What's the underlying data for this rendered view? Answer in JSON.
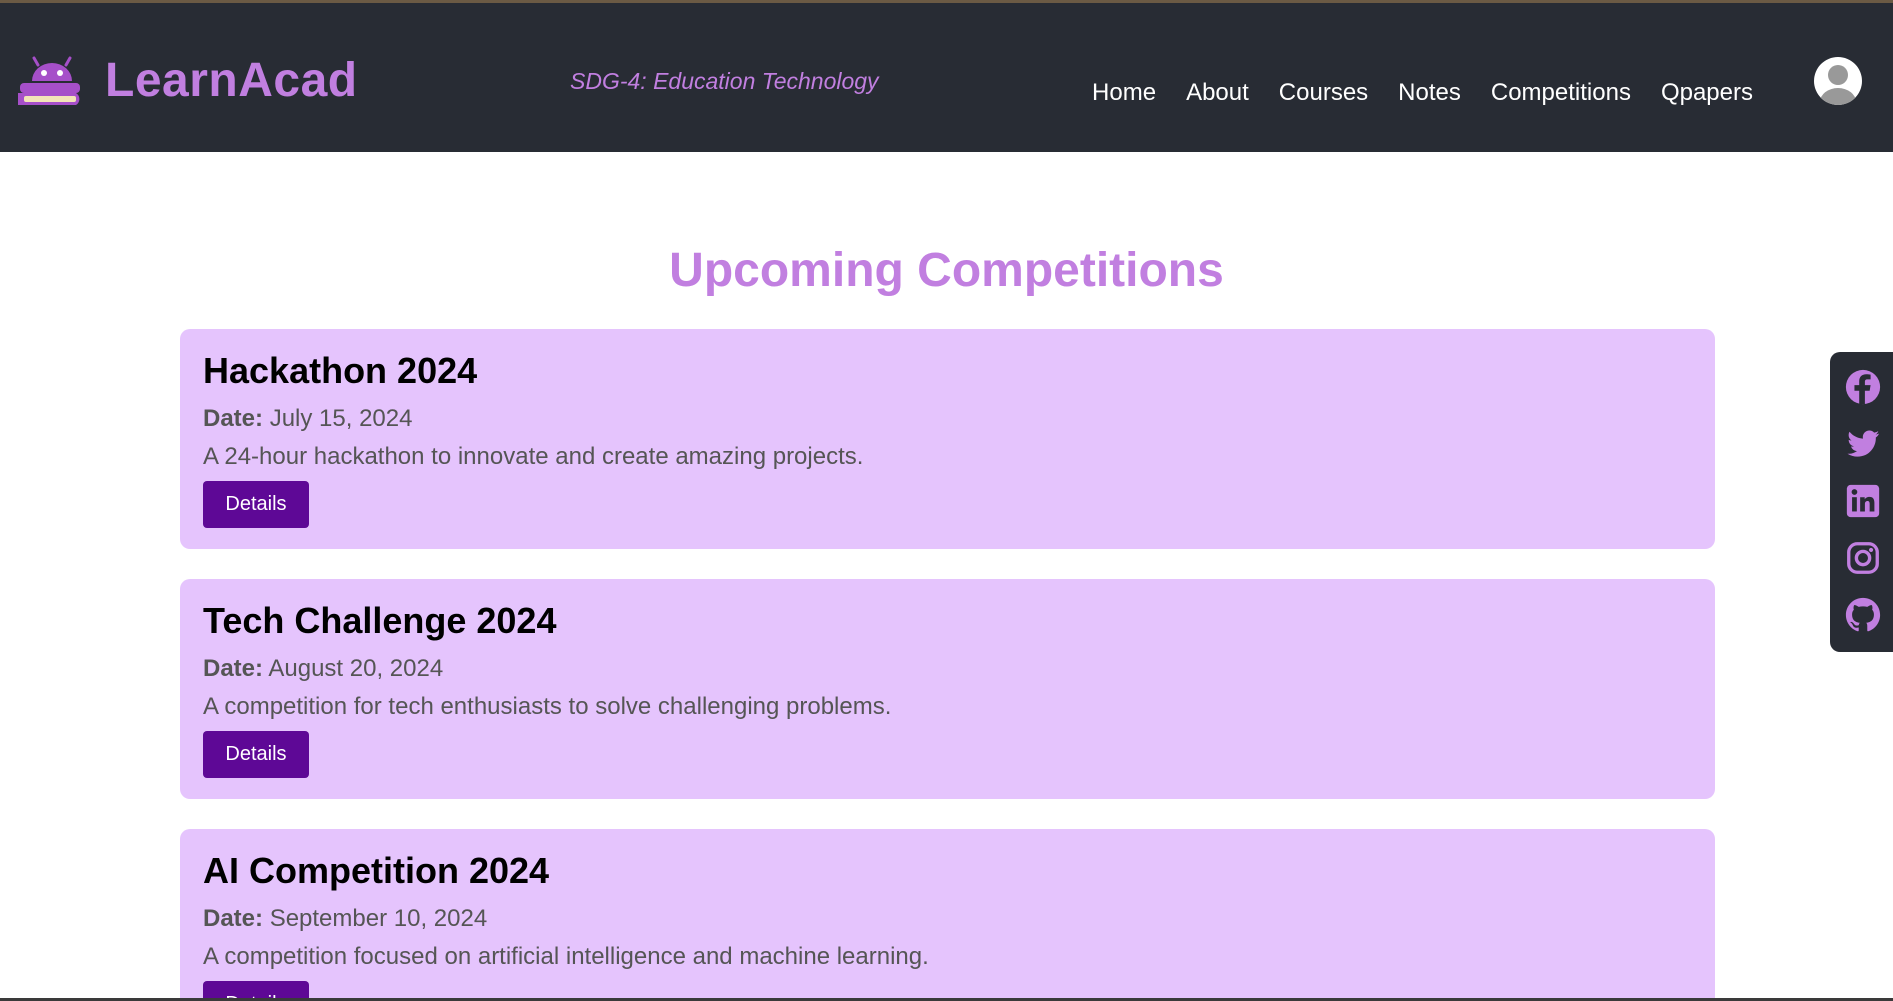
{
  "header": {
    "brand": "LearnAcad",
    "tagline": "SDG-4: Education Technology",
    "nav": [
      {
        "label": "Home"
      },
      {
        "label": "About"
      },
      {
        "label": "Courses"
      },
      {
        "label": "Notes"
      },
      {
        "label": "Competitions"
      },
      {
        "label": "Qpapers"
      }
    ]
  },
  "main": {
    "title": "Upcoming Competitions",
    "date_label": "Date:",
    "competitions": [
      {
        "name": "Hackathon 2024",
        "date": "July 15, 2024",
        "description": "A 24-hour hackathon to innovate and create amazing projects.",
        "button": "Details"
      },
      {
        "name": "Tech Challenge 2024",
        "date": "August 20, 2024",
        "description": "A competition for tech enthusiasts to solve challenging problems.",
        "button": "Details"
      },
      {
        "name": "AI Competition 2024",
        "date": "September 10, 2024",
        "description": "A competition focused on artificial intelligence and machine learning.",
        "button": "Details"
      }
    ]
  },
  "social": {
    "icons": [
      "facebook-icon",
      "twitter-icon",
      "linkedin-icon",
      "instagram-icon",
      "github-icon"
    ]
  },
  "colors": {
    "accent": "#c17fe0",
    "header_bg": "#282c34",
    "card_bg": "#e5c4fd",
    "button_bg": "#5e0896"
  }
}
